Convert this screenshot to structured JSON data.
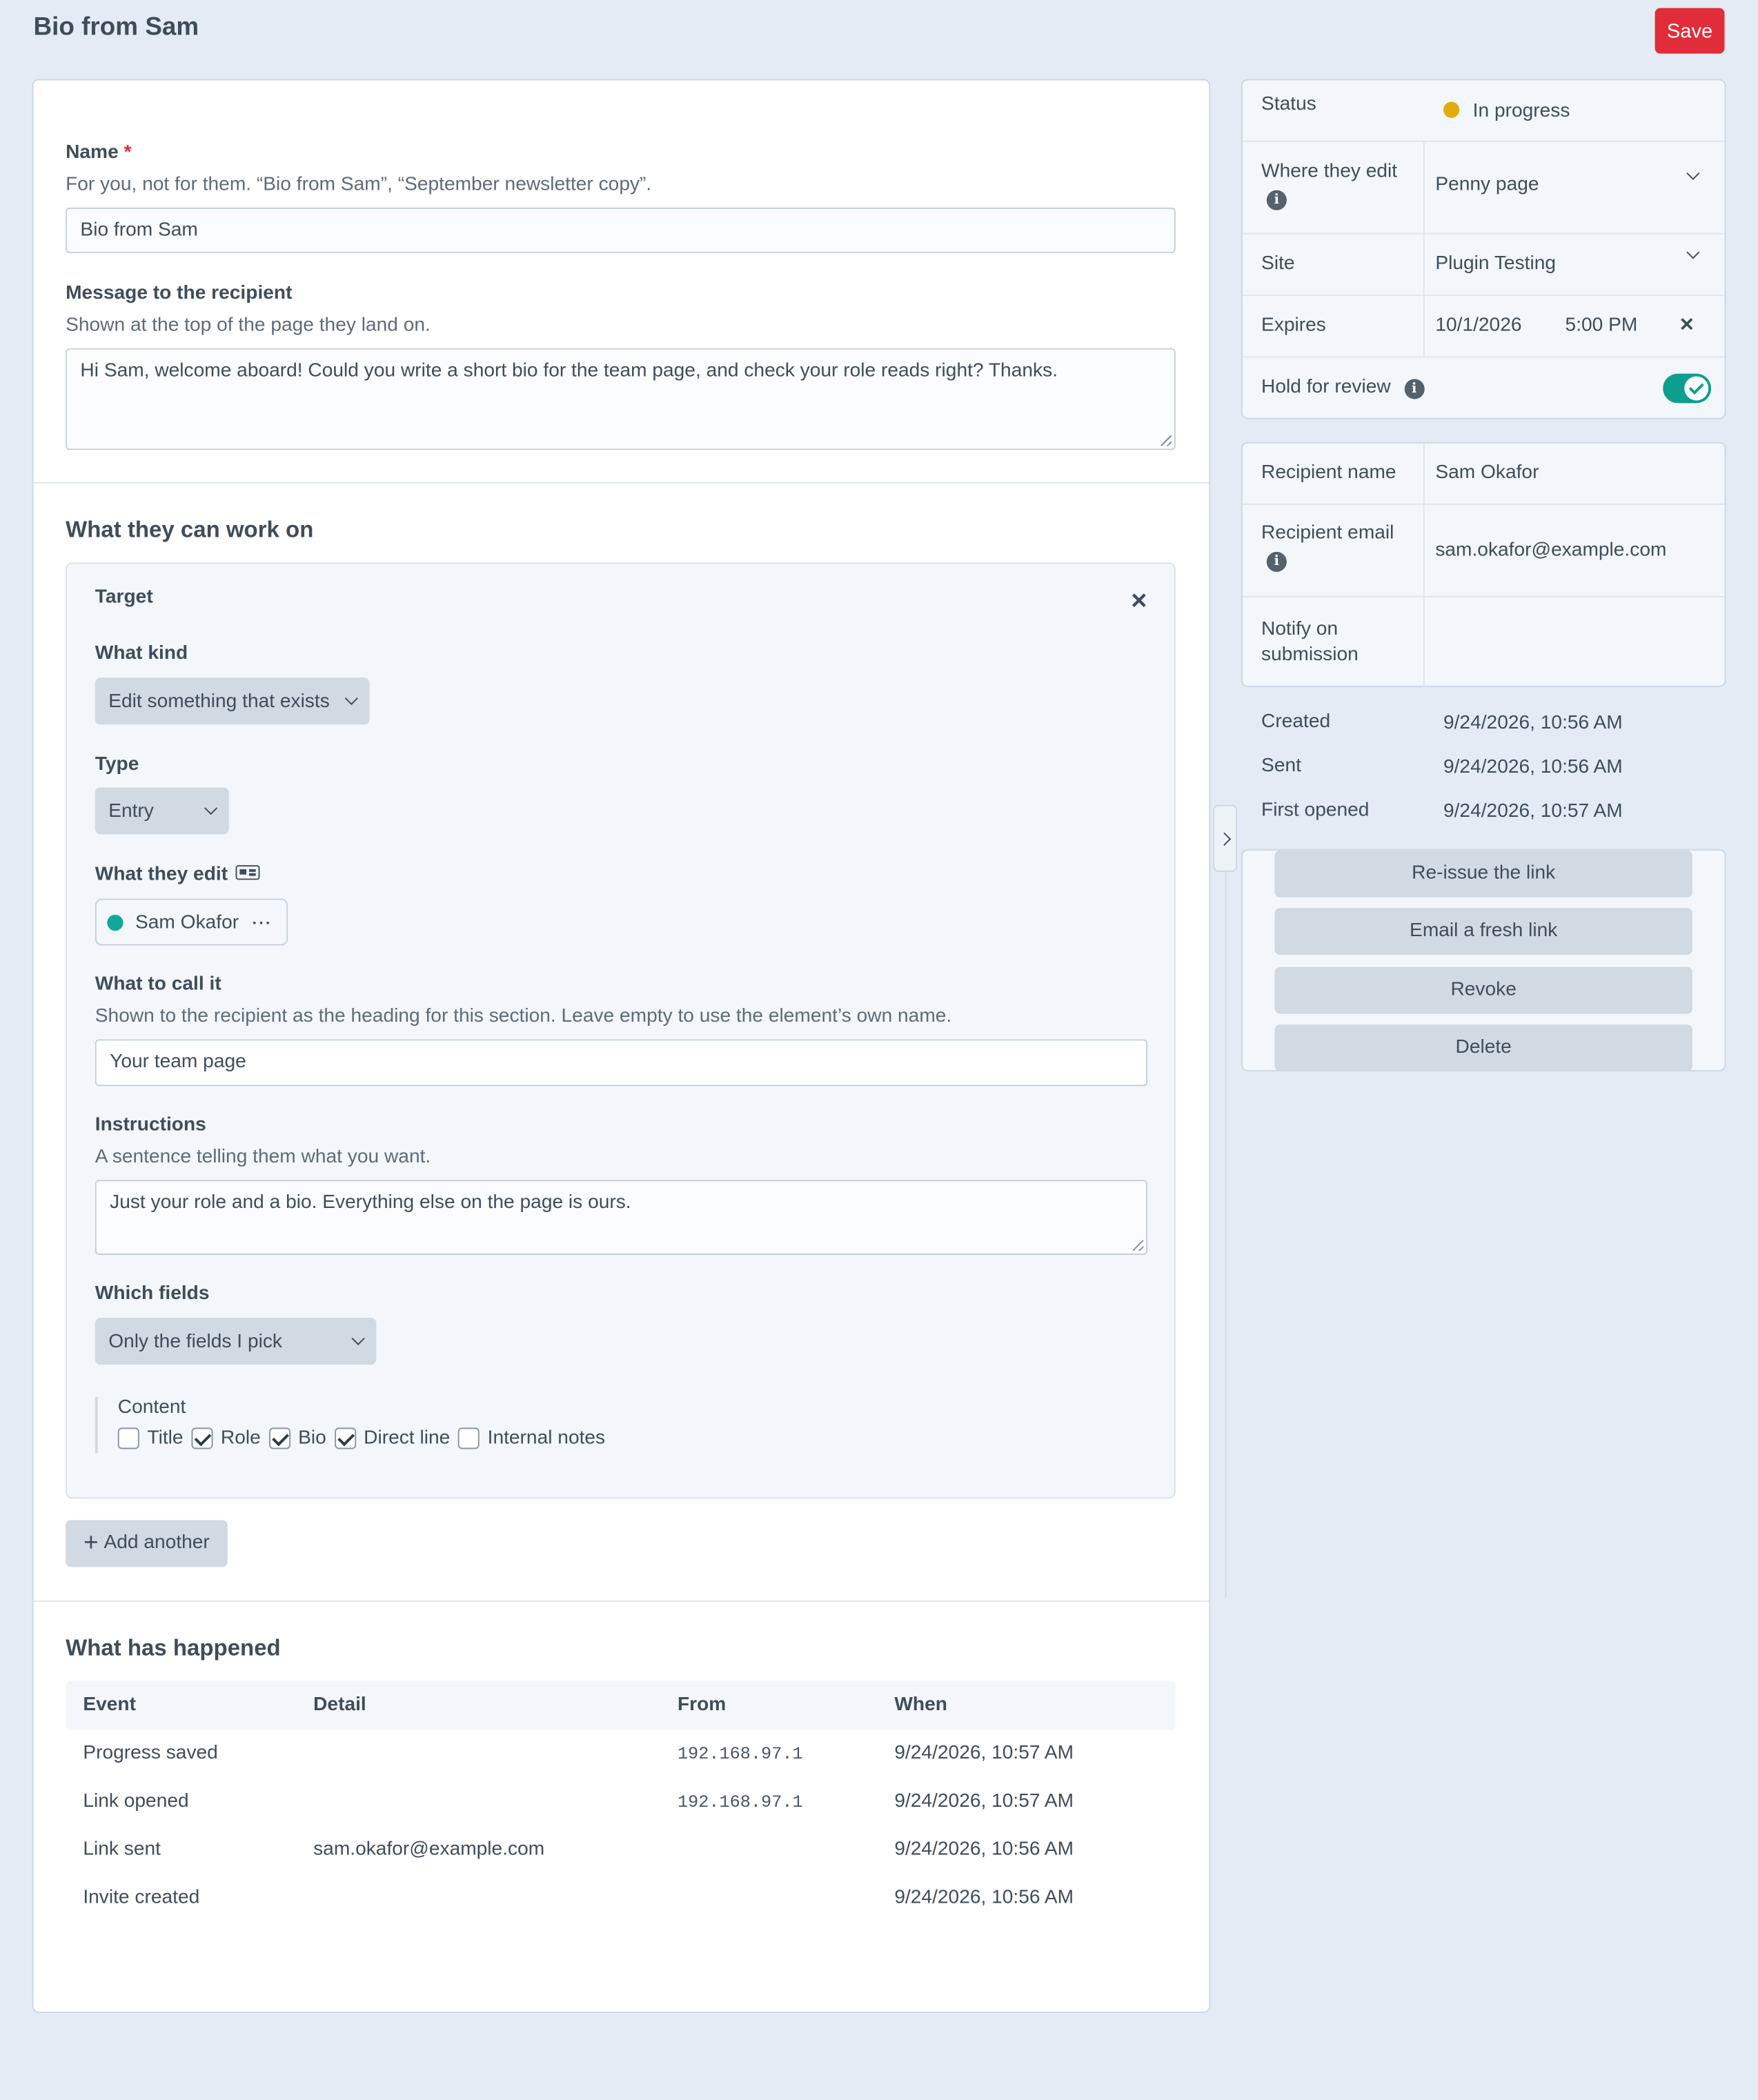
{
  "header": {
    "title": "Bio from Sam",
    "save_label": "Save"
  },
  "form": {
    "name": {
      "label": "Name",
      "required_mark": "*",
      "hint": "For you, not for them. “Bio from Sam”, “September newsletter copy”.",
      "value": "Bio from Sam"
    },
    "message": {
      "label": "Message to the recipient",
      "hint": "Shown at the top of the page they land on.",
      "value": "Hi Sam, welcome aboard! Could you write a short bio for the team page, and check your role reads right? Thanks."
    },
    "work_section_title": "What they can work on",
    "target": {
      "title": "Target",
      "kind_label": "What kind",
      "kind_value": "Edit something that exists",
      "type_label": "Type",
      "type_value": "Entry",
      "edit_label": "What they edit",
      "edit_chip": "Sam Okafor",
      "call_label": "What to call it",
      "call_hint": "Shown to the recipient as the heading for this section. Leave empty to use the element’s own name.",
      "call_value": "Your team page",
      "instructions_label": "Instructions",
      "instructions_hint": "A sentence telling them what you want.",
      "instructions_value": "Just your role and a bio. Everything else on the page is ours.",
      "fields_label": "Which fields",
      "fields_value": "Only the fields I pick",
      "group_label": "Content",
      "checkboxes": [
        {
          "label": "Title",
          "checked": false
        },
        {
          "label": "Role",
          "checked": true
        },
        {
          "label": "Bio",
          "checked": true
        },
        {
          "label": "Direct line",
          "checked": true
        },
        {
          "label": "Internal notes",
          "checked": false
        }
      ]
    },
    "add_another_label": "Add another"
  },
  "history": {
    "title": "What has happened",
    "columns": [
      "Event",
      "Detail",
      "From",
      "When"
    ],
    "rows": [
      {
        "event": "Progress saved",
        "detail": "",
        "from": "192.168.97.1",
        "when": "9/24/2026, 10:57 AM"
      },
      {
        "event": "Link opened",
        "detail": "",
        "from": "192.168.97.1",
        "when": "9/24/2026, 10:57 AM"
      },
      {
        "event": "Link sent",
        "detail": "sam.okafor@example.com",
        "from": "",
        "when": "9/24/2026, 10:56 AM"
      },
      {
        "event": "Invite created",
        "detail": "",
        "from": "",
        "when": "9/24/2026, 10:56 AM"
      }
    ]
  },
  "sidebar": {
    "status_label": "Status",
    "status_value": "In progress",
    "where_label": "Where they edit",
    "where_value": "Penny page",
    "site_label": "Site",
    "site_value": "Plugin Testing",
    "expires_label": "Expires",
    "expires_date": "10/1/2026",
    "expires_time": "5:00 PM",
    "hold_label": "Hold for review",
    "hold_on": true,
    "recipient_name_label": "Recipient name",
    "recipient_name": "Sam Okafor",
    "recipient_email_label": "Recipient email",
    "recipient_email": "sam.okafor@example.com",
    "notify_label": "Notify on submission",
    "notify_value": "",
    "created_label": "Created",
    "created_value": "9/24/2026, 10:56 AM",
    "sent_label": "Sent",
    "sent_value": "9/24/2026, 10:56 AM",
    "opened_label": "First opened",
    "opened_value": "9/24/2026, 10:57 AM",
    "actions": [
      "Re-issue the link",
      "Email a fresh link",
      "Revoke",
      "Delete"
    ]
  },
  "colors": {
    "save": "#e12d39",
    "status_amber": "#e3ac0c",
    "toggle_teal": "#0d9e90",
    "chip_dot": "#10a89a",
    "background": "#e4ebf4"
  }
}
